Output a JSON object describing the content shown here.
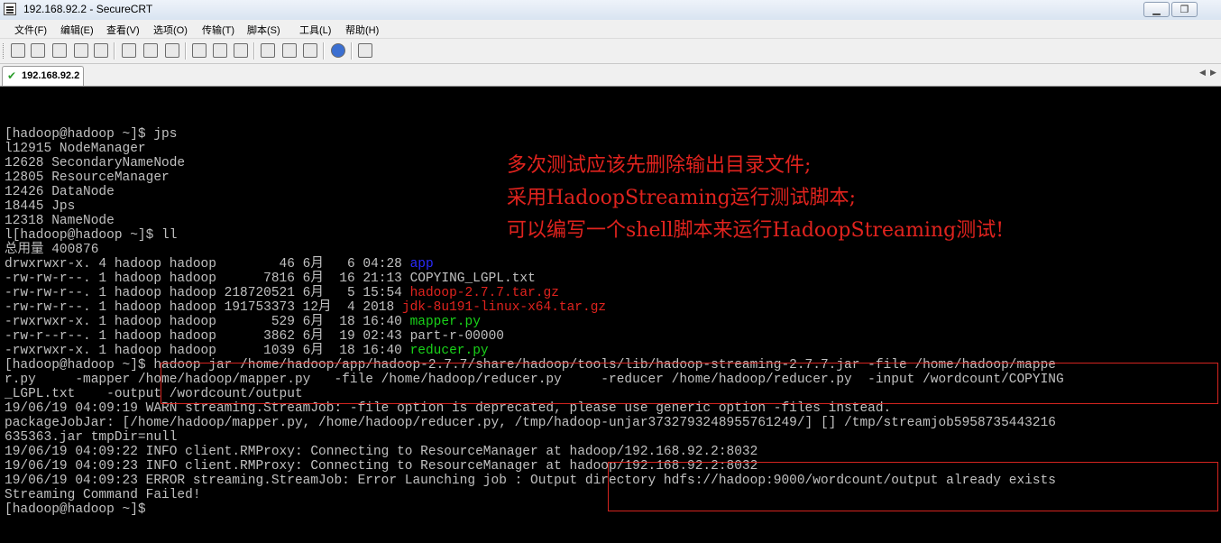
{
  "window": {
    "title": "192.168.92.2 - SecureCRT"
  },
  "menu": [
    "文件(F)",
    "编辑(E)",
    "查看(V)",
    "选项(O)",
    "传输(T)",
    "脚本(S)",
    "工具(L)",
    "帮助(H)"
  ],
  "tab": {
    "label": "192.168.92.2"
  },
  "terminal": {
    "lines": [
      {
        "segments": [
          {
            "t": "[hadoop@hadoop ~]$ jps",
            "c": "white"
          }
        ]
      },
      {
        "segments": [
          {
            "t": "l12915 NodeManager",
            "c": "white"
          }
        ]
      },
      {
        "segments": [
          {
            "t": "12628 SecondaryNameNode",
            "c": "white"
          }
        ]
      },
      {
        "segments": [
          {
            "t": "12805 ResourceManager",
            "c": "white"
          }
        ]
      },
      {
        "segments": [
          {
            "t": "12426 DataNode",
            "c": "white"
          }
        ]
      },
      {
        "segments": [
          {
            "t": "18445 Jps",
            "c": "white"
          }
        ]
      },
      {
        "segments": [
          {
            "t": "12318 NameNode",
            "c": "white"
          }
        ]
      },
      {
        "segments": [
          {
            "t": "l[hadoop@hadoop ~]$ ll",
            "c": "white"
          }
        ]
      },
      {
        "segments": [
          {
            "t": "总用量 400876",
            "c": "white"
          }
        ]
      },
      {
        "segments": [
          {
            "t": "drwxrwxr-x. 4 hadoop hadoop        46 6月   6 04:28 ",
            "c": "white"
          },
          {
            "t": "app",
            "c": "blue"
          }
        ]
      },
      {
        "segments": [
          {
            "t": "-rw-rw-r--. 1 hadoop hadoop      7816 6月  16 21:13 COPYING_LGPL.txt",
            "c": "white"
          }
        ]
      },
      {
        "segments": [
          {
            "t": "-rw-rw-r--. 1 hadoop hadoop 218720521 6月   5 15:54 ",
            "c": "white"
          },
          {
            "t": "hadoop-2.7.7.tar.gz",
            "c": "red"
          }
        ]
      },
      {
        "segments": [
          {
            "t": "-rw-rw-r--. 1 hadoop hadoop 191753373 12月  4 2018 ",
            "c": "white"
          },
          {
            "t": "jdk-8u191-linux-x64.tar.gz",
            "c": "red"
          }
        ]
      },
      {
        "segments": [
          {
            "t": "-rwxrwxr-x. 1 hadoop hadoop       529 6月  18 16:40 ",
            "c": "white"
          },
          {
            "t": "mapper.py",
            "c": "green"
          }
        ]
      },
      {
        "segments": [
          {
            "t": "-rw-r--r--. 1 hadoop hadoop      3862 6月  19 02:43 part-r-00000",
            "c": "white"
          }
        ]
      },
      {
        "segments": [
          {
            "t": "-rwxrwxr-x. 1 hadoop hadoop      1039 6月  18 16:40 ",
            "c": "white"
          },
          {
            "t": "reducer.py",
            "c": "green"
          }
        ]
      },
      {
        "segments": [
          {
            "t": "[hadoop@hadoop ~]$ hadoop jar /home/hadoop/app/hadoop-2.7.7/share/hadoop/tools/lib/hadoop-streaming-2.7.7.jar -file /home/hadoop/mappe",
            "c": "white"
          }
        ]
      },
      {
        "segments": [
          {
            "t": "r.py     -mapper /home/hadoop/mapper.py   -file /home/hadoop/reducer.py     -reducer /home/hadoop/reducer.py  -input /wordcount/COPYING",
            "c": "white"
          }
        ]
      },
      {
        "segments": [
          {
            "t": "_LGPL.txt    -output /wordcount/output",
            "c": "white"
          }
        ]
      },
      {
        "segments": [
          {
            "t": "19/06/19 04:09:19 WARN streaming.StreamJob: -file option is deprecated, please use generic option -files instead.",
            "c": "white"
          }
        ]
      },
      {
        "segments": [
          {
            "t": "packageJobJar: [/home/hadoop/mapper.py, /home/hadoop/reducer.py, /tmp/hadoop-unjar3732793248955761249/] [] /tmp/streamjob5958735443216",
            "c": "white"
          }
        ]
      },
      {
        "segments": [
          {
            "t": "635363.jar tmpDir=null",
            "c": "white"
          }
        ]
      },
      {
        "segments": [
          {
            "t": "19/06/19 04:09:22 INFO client.RMProxy: Connecting to ResourceManager at hadoop/192.168.92.2:8032",
            "c": "white"
          }
        ]
      },
      {
        "segments": [
          {
            "t": "19/06/19 04:09:23 INFO client.RMProxy: Connecting to ResourceManager at hadoop/192.168.92.2:8032",
            "c": "white"
          }
        ]
      },
      {
        "segments": [
          {
            "t": "19/06/19 04:09:23 ERROR streaming.StreamJob: Error Launching job : Output directory hdfs://hadoop:9000/wordcount/output already exists",
            "c": "white"
          }
        ]
      },
      {
        "segments": [
          {
            "t": "Streaming Command Failed!",
            "c": "white"
          }
        ]
      },
      {
        "segments": [
          {
            "t": "[hadoop@hadoop ~]$ ",
            "c": "white"
          }
        ]
      }
    ]
  },
  "annotation": {
    "lines": [
      "多次测试应该先删除输出目录文件;",
      "采用HadoopStreaming运行测试脚本;",
      "可以编写一个shell脚本来运行HadoopStreaming测试!"
    ]
  }
}
